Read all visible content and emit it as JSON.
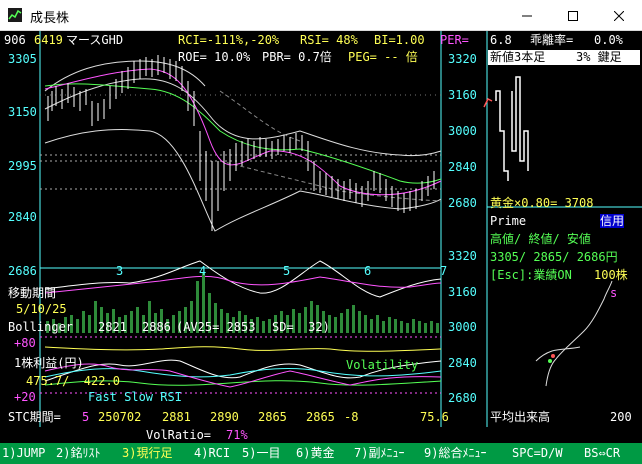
{
  "window": {
    "title": "成長株"
  },
  "header": {
    "row": "906",
    "code": "6419",
    "name": "マースGHD",
    "rci": "RCI=-111%,-20%",
    "rsi": "RSI= 48%",
    "bi": "BI=1.00",
    "per": "PER=",
    "roe": "ROE= 10.0%",
    "pbr": "PBR= 0.7倍",
    "peg": "PEG= -- 倍"
  },
  "price_axis": {
    "labels": [
      "3305",
      "3150",
      "2995",
      "2840",
      "2686"
    ]
  },
  "date_axis": {
    "labels": [
      "3",
      "4",
      "5",
      "6",
      "7"
    ]
  },
  "rsi_panel": {
    "title": "移動期間",
    "periods": "5/10/25"
  },
  "bollinger": {
    "label": "Bollinger",
    "upper": "2821",
    "middle": "2886",
    "av": "(AV25= 2853",
    "sd": "SD=  32)"
  },
  "eps_panel": {
    "plus80": "+80",
    "title": "1株利益(円)",
    "values": "475.7/  422.0",
    "volatility": "Volatility",
    "plus20": "+20",
    "stoch_label": "Fast Slow RSI"
  },
  "stc_row": {
    "label": "STC期間=",
    "period": "5",
    "date": "250702",
    "o": "2881",
    "h": "2890",
    "l": "2865",
    "c": "2865",
    "chg": "-8",
    "pct": "75.6"
  },
  "vol_ratio": {
    "label": "VolRatio=",
    "value": "71%"
  },
  "right_panel": {
    "dev_value": "6.8",
    "dev_label": "乖離率=",
    "dev_pct": "0.0%",
    "three_line": "新値3本足",
    "kagi": "3% 鍵足",
    "top_axis": [
      "3320",
      "3160",
      "3000",
      "2840",
      "2680"
    ],
    "golden": "黄金×0.80= 3708",
    "prime": "Prime",
    "credit": "信用",
    "hl_labels": "高値/ 終値/ 安値",
    "hl_values": "3305/ 2865/ 2686円",
    "esc": "[Esc]:業績ON",
    "lot": "100株",
    "bottom_axis": [
      "3320",
      "3160",
      "3000",
      "2840",
      "2680"
    ],
    "vol_avg": "平均出来高",
    "vol_max": "200",
    "s_marker": "s"
  },
  "function_keys": [
    {
      "label": "1)JUMP",
      "selected": false
    },
    {
      "label": "2)銘ﾘｽﾄ",
      "selected": false
    },
    {
      "label": "3)現行足",
      "selected": true
    },
    {
      "label": "4)RCI",
      "selected": false
    },
    {
      "label": "5)一目",
      "selected": false
    },
    {
      "label": "6)黄金",
      "selected": false
    },
    {
      "label": "7)副ﾒﾆｭｰ",
      "selected": false
    },
    {
      "label": "9)総合ﾒﾆｭｰ",
      "selected": false
    },
    {
      "label": "SPC=D/W",
      "selected": false
    },
    {
      "label": "BS⇔CR",
      "selected": false
    }
  ],
  "colors": {
    "background": "#000000",
    "price_line": "#ffffff",
    "ma_short": "#ff55ff",
    "ma_mid": "#55ff55",
    "volume": "#2e8b3a",
    "function_bar": "#009a44"
  },
  "icons": [
    "chart-app-icon",
    "minimize-icon",
    "maximize-icon",
    "close-icon"
  ]
}
